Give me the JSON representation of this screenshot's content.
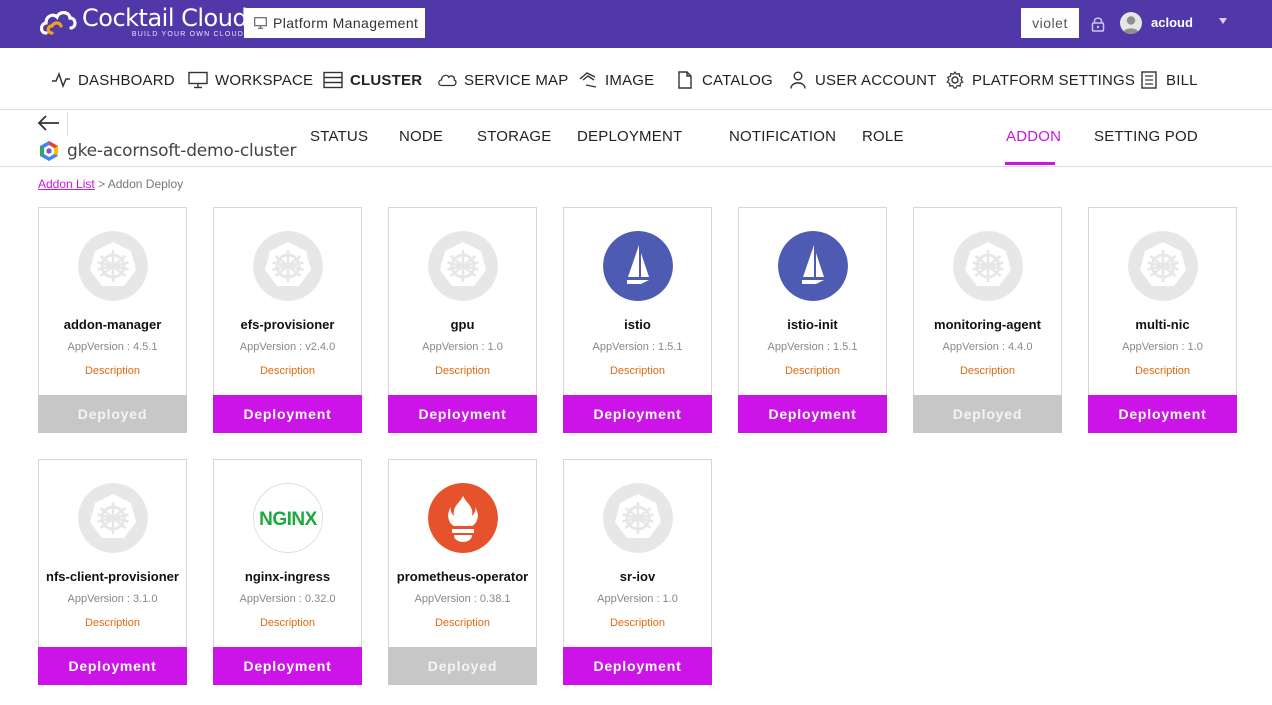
{
  "header": {
    "logo_name": "Cocktail Cloud",
    "logo_tagline": "BUILD YOUR OWN CLOUD!",
    "platform_button": "Platform Management",
    "theme": "violet",
    "user": "acloud"
  },
  "colors": {
    "topbar": "#5138a8",
    "accent": "#cc14e8",
    "deployed_button": "#c7c7c7",
    "description_link": "#e06a10"
  },
  "nav": {
    "items": [
      {
        "label": "DASHBOARD",
        "icon": "pulse-icon"
      },
      {
        "label": "WORKSPACE",
        "icon": "monitor-icon"
      },
      {
        "label": "CLUSTER",
        "icon": "server-icon",
        "active": true
      },
      {
        "label": "SERVICE MAP",
        "icon": "cloud-icon"
      },
      {
        "label": "IMAGE",
        "icon": "image-icon"
      },
      {
        "label": "CATALOG",
        "icon": "document-icon"
      },
      {
        "label": "USER ACCOUNT",
        "icon": "user-icon"
      },
      {
        "label": "PLATFORM SETTINGS",
        "icon": "gear-icon"
      },
      {
        "label": "BILL",
        "icon": "bill-icon"
      }
    ]
  },
  "cluster": {
    "name": "gke-acornsoft-demo-cluster",
    "tabs": [
      "STATUS",
      "NODE",
      "STORAGE",
      "DEPLOYMENT",
      "NOTIFICATION",
      "ROLE",
      "ADDON",
      "SETTING POD"
    ],
    "active_tab": "ADDON"
  },
  "breadcrumb": {
    "link": "Addon List",
    "separator": ">",
    "current": "Addon Deploy"
  },
  "addons": [
    {
      "name": "addon-manager",
      "version": "AppVersion : 4.5.1",
      "description": "Description",
      "button": "Deployed",
      "status": "deployed",
      "icon": "kubernetes-icon"
    },
    {
      "name": "efs-provisioner",
      "version": "AppVersion : v2.4.0",
      "description": "Description",
      "button": "Deployment",
      "status": "deploy",
      "icon": "kubernetes-icon"
    },
    {
      "name": "gpu",
      "version": "AppVersion : 1.0",
      "description": "Description",
      "button": "Deployment",
      "status": "deploy",
      "icon": "kubernetes-icon"
    },
    {
      "name": "istio",
      "version": "AppVersion : 1.5.1",
      "description": "Description",
      "button": "Deployment",
      "status": "deploy",
      "icon": "istio-icon"
    },
    {
      "name": "istio-init",
      "version": "AppVersion : 1.5.1",
      "description": "Description",
      "button": "Deployment",
      "status": "deploy",
      "icon": "istio-icon"
    },
    {
      "name": "monitoring-agent",
      "version": "AppVersion : 4.4.0",
      "description": "Description",
      "button": "Deployed",
      "status": "deployed",
      "icon": "kubernetes-icon"
    },
    {
      "name": "multi-nic",
      "version": "AppVersion : 1.0",
      "description": "Description",
      "button": "Deployment",
      "status": "deploy",
      "icon": "kubernetes-icon"
    },
    {
      "name": "nfs-client-provisioner",
      "version": "AppVersion : 3.1.0",
      "description": "Description",
      "button": "Deployment",
      "status": "deploy",
      "icon": "kubernetes-icon"
    },
    {
      "name": "nginx-ingress",
      "version": "AppVersion : 0.32.0",
      "description": "Description",
      "button": "Deployment",
      "status": "deploy",
      "icon": "nginx-icon",
      "icon_text": "NGINX"
    },
    {
      "name": "prometheus-operator",
      "version": "AppVersion : 0.38.1",
      "description": "Description",
      "button": "Deployed",
      "status": "deployed",
      "icon": "prometheus-icon"
    },
    {
      "name": "sr-iov",
      "version": "AppVersion : 1.0",
      "description": "Description",
      "button": "Deployment",
      "status": "deploy",
      "icon": "kubernetes-icon"
    }
  ]
}
